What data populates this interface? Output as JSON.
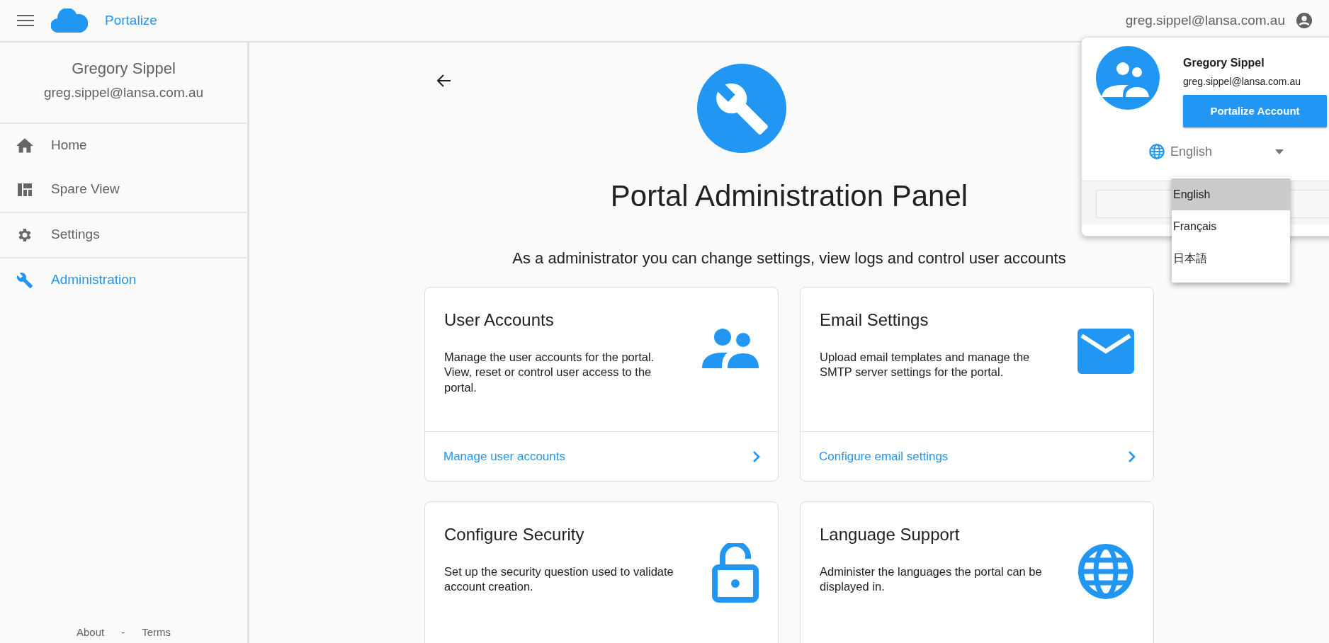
{
  "header": {
    "app_name": "Portalize",
    "user_email": "greg.sippel@lansa.com.au"
  },
  "sidebar": {
    "user_name": "Gregory Sippel",
    "user_email": "greg.sippel@lansa.com.au",
    "sections": [
      {
        "items": [
          {
            "label": "Home",
            "kind": "home",
            "selected": false
          },
          {
            "label": "Spare View",
            "kind": "dashboard",
            "selected": false
          }
        ]
      },
      {
        "items": [
          {
            "label": "Settings",
            "kind": "gear",
            "selected": false
          }
        ]
      },
      {
        "items": [
          {
            "label": "Administration",
            "kind": "wrench",
            "selected": true
          }
        ]
      }
    ],
    "footer": [
      "About",
      "-",
      "Terms"
    ]
  },
  "main": {
    "title": "Portal Administration Panel",
    "subtitle": "As a administrator you can change settings, view logs and control user accounts",
    "cards": [
      {
        "title": "User Accounts",
        "description": "Manage the user accounts for the portal. View, reset or control user access to the portal.",
        "link": "Manage user accounts",
        "kind": "people"
      },
      {
        "title": "Email Settings",
        "description": "Upload email templates and manage the SMTP server settings for the portal.",
        "link": "Configure email settings",
        "kind": "mail"
      },
      {
        "title": "Configure Security",
        "description": "Set up the security question used to validate account creation.",
        "kind": "lock"
      },
      {
        "title": "Language Support",
        "description": "Administer the languages the portal can be displayed in.",
        "kind": "globe"
      }
    ]
  },
  "account_popup": {
    "name": "Gregory Sippel",
    "email": "greg.sippel@lansa.com.au",
    "button": "Portalize Account",
    "language": "English",
    "expanded": true,
    "language_options": [
      {
        "label": "English",
        "selected": true
      },
      {
        "label": "Français",
        "selected": false
      },
      {
        "label": "日本語",
        "selected": false
      }
    ]
  }
}
